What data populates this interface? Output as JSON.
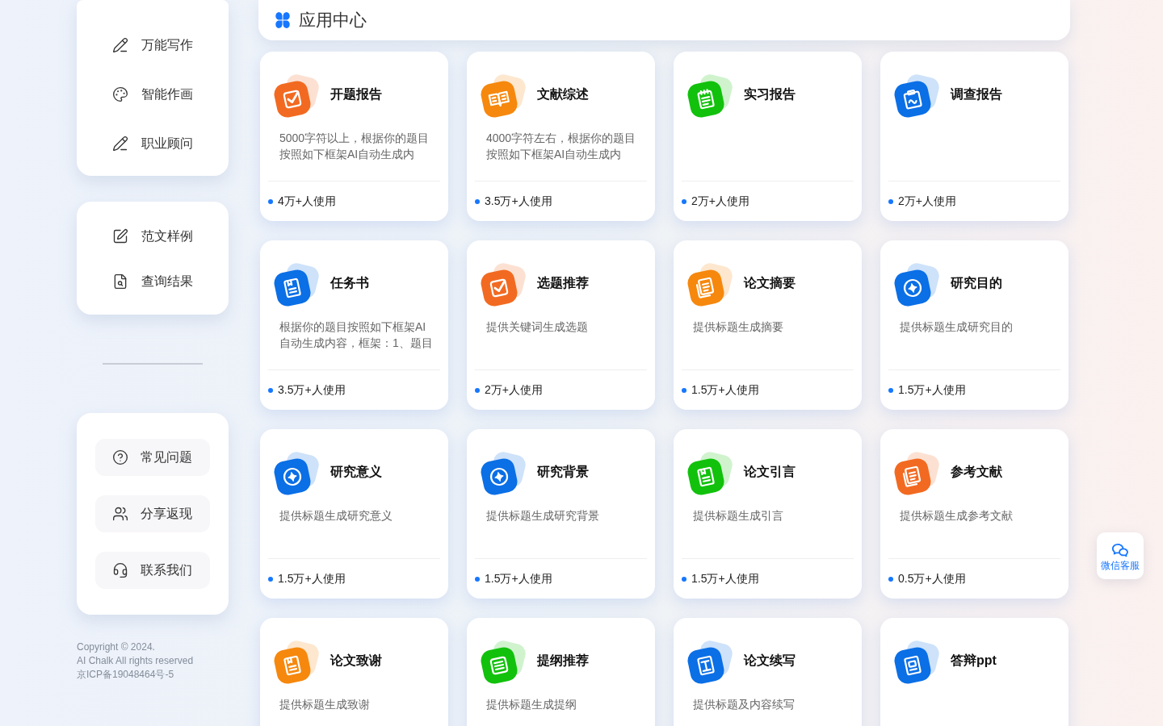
{
  "sidebar_menu": [
    {
      "label": "万能写作"
    },
    {
      "label": "智能作画"
    },
    {
      "label": "职业顾问"
    }
  ],
  "sidebar_links": [
    {
      "label": "范文样例"
    },
    {
      "label": "查询结果"
    }
  ],
  "sidebar_buttons": [
    {
      "label": "常见问题"
    },
    {
      "label": "分享返现"
    },
    {
      "label": "联系我们"
    }
  ],
  "copyright": [
    "Copyright © 2024.",
    "AI Chalk All rights reserved",
    "京ICP备19048464号-5"
  ],
  "app_center": {
    "title": "应用中心",
    "apps": [
      {
        "name": "开题报告",
        "description": [
          "5000字符以上，根据你的题目",
          "按照如下框架AI自动生成内"
        ],
        "usage": "4万+人使用"
      },
      {
        "name": "文献综述",
        "description": [
          "4000字符左右，根据你的题目",
          "按照如下框架AI自动生成内"
        ],
        "usage": "3.5万+人使用"
      },
      {
        "name": "实习报告",
        "usage": "2万+人使用"
      },
      {
        "name": "调查报告",
        "usage": "2万+人使用"
      },
      {
        "name": "任务书",
        "description": [
          "根据你的题目按照如下框架AI",
          "自动生成内容，框架：1、题目"
        ],
        "usage": "3.5万+人使用"
      },
      {
        "name": "选题推荐",
        "description": [
          "提供关键词生成选题"
        ],
        "usage": "2万+人使用"
      },
      {
        "name": "论文摘要",
        "description": [
          "提供标题生成摘要"
        ],
        "usage": "1.5万+人使用"
      },
      {
        "name": "研究目的",
        "description": [
          "提供标题生成研究目的"
        ],
        "usage": "1.5万+人使用"
      },
      {
        "name": "研究意义",
        "description": [
          "提供标题生成研究意义"
        ],
        "usage": "1.5万+人使用"
      },
      {
        "name": "研究背景",
        "description": [
          "提供标题生成研究背景"
        ],
        "usage": "1.5万+人使用"
      },
      {
        "name": "论文引言",
        "description": [
          "提供标题生成引言"
        ],
        "usage": "1.5万+人使用"
      },
      {
        "name": "参考文献",
        "description": [
          "提供标题生成参考文献"
        ],
        "usage": "0.5万+人使用"
      },
      {
        "name": "论文致谢",
        "description": [
          "提供标题生成致谢"
        ]
      },
      {
        "name": "提纲推荐",
        "description": [
          "提供标题生成提纲"
        ]
      },
      {
        "name": "论文续写",
        "description": [
          "提供标题及内容续写"
        ]
      },
      {
        "name": "答辩ppt"
      }
    ]
  },
  "floating_button": {
    "label": "微信客服"
  }
}
